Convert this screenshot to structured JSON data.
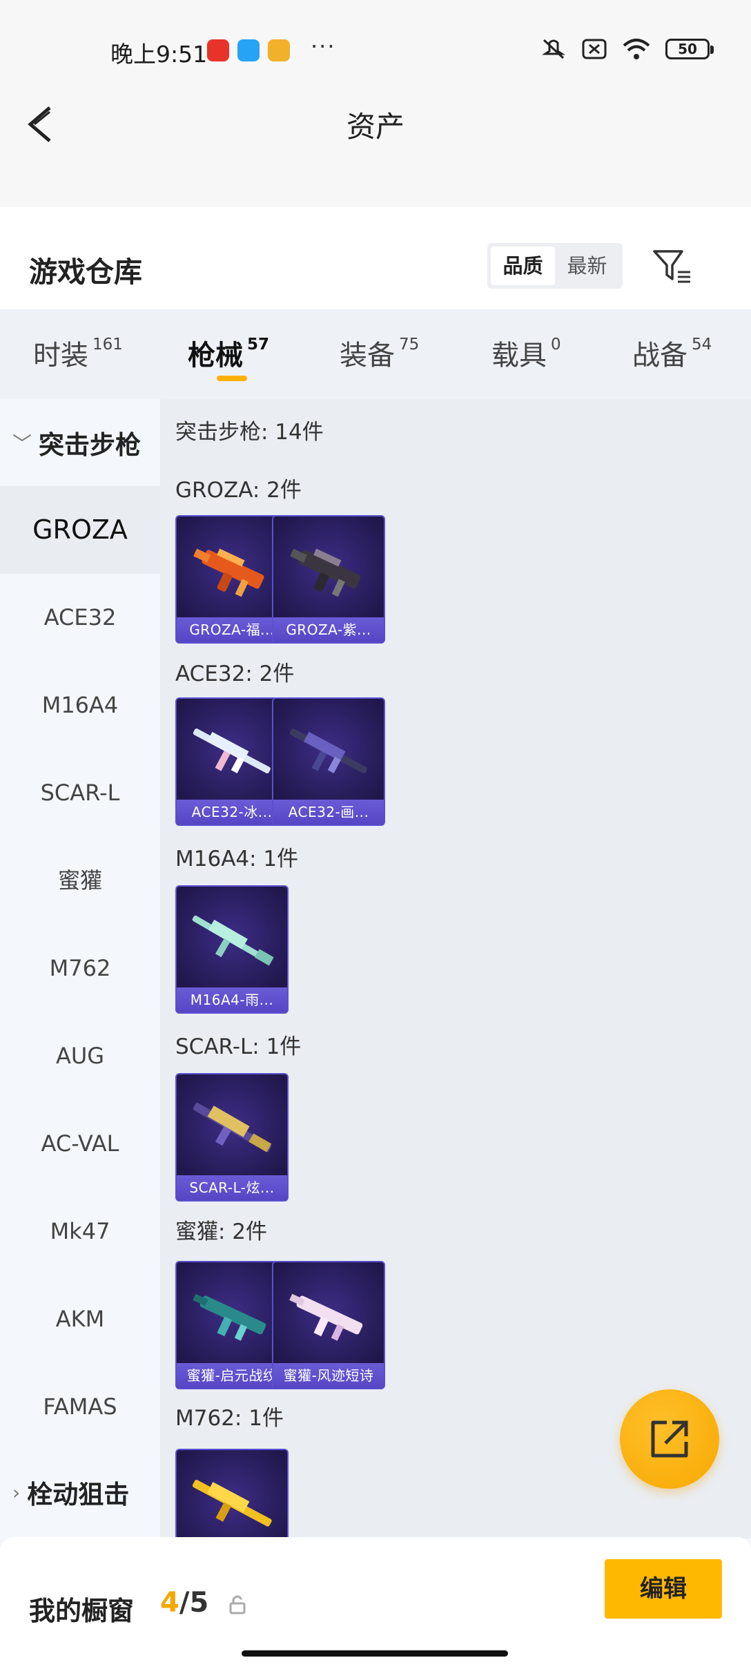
{
  "status_bar": {
    "time": "晚上9:51",
    "battery": "50"
  },
  "header": {
    "title": "资产",
    "back_icon": "chevron-left-icon"
  },
  "warehouse": {
    "title": "游戏仓库",
    "sort_options": [
      "品质",
      "最新"
    ],
    "sort_selected": "品质"
  },
  "tabs": [
    {
      "label": "时装",
      "count": "161"
    },
    {
      "label": "枪械",
      "count": "57"
    },
    {
      "label": "装备",
      "count": "75"
    },
    {
      "label": "载具",
      "count": "0"
    },
    {
      "label": "战备",
      "count": "54"
    }
  ],
  "active_tab": "枪械",
  "sidebar": {
    "group_expanded": "突击步枪",
    "items": [
      "GROZA",
      "ACE32",
      "M16A4",
      "SCAR-L",
      "蜜獾",
      "M762",
      "AUG",
      "AC-VAL",
      "Mk47",
      "AKM",
      "FAMAS"
    ],
    "active_item": "GROZA",
    "group_collapsed": "栓动狙击"
  },
  "main": {
    "section_title": "突击步枪: 14件",
    "groups": [
      {
        "title": "GROZA: 2件",
        "cards": [
          "GROZA-福...",
          "GROZA-紫..."
        ]
      },
      {
        "title": "ACE32: 2件",
        "cards": [
          "ACE32-冰...",
          "ACE32-画..."
        ]
      },
      {
        "title": "M16A4: 1件",
        "cards": [
          "M16A4-雨..."
        ]
      },
      {
        "title": "SCAR-L: 1件",
        "cards": [
          "SCAR-L-炫..."
        ]
      },
      {
        "title": "蜜獾: 2件",
        "cards": [
          "蜜獾-启元战纹",
          "蜜獾-风迹短诗"
        ]
      },
      {
        "title": "M762: 1件",
        "cards": [
          ""
        ]
      }
    ]
  },
  "bottom_bar": {
    "title": "我的橱窗",
    "current": "4",
    "total": "/5",
    "edit_label": "编辑"
  },
  "colors": {
    "accent": "#ffb800",
    "card_border": "#5b4fd1",
    "card_label": "#5646c5"
  }
}
